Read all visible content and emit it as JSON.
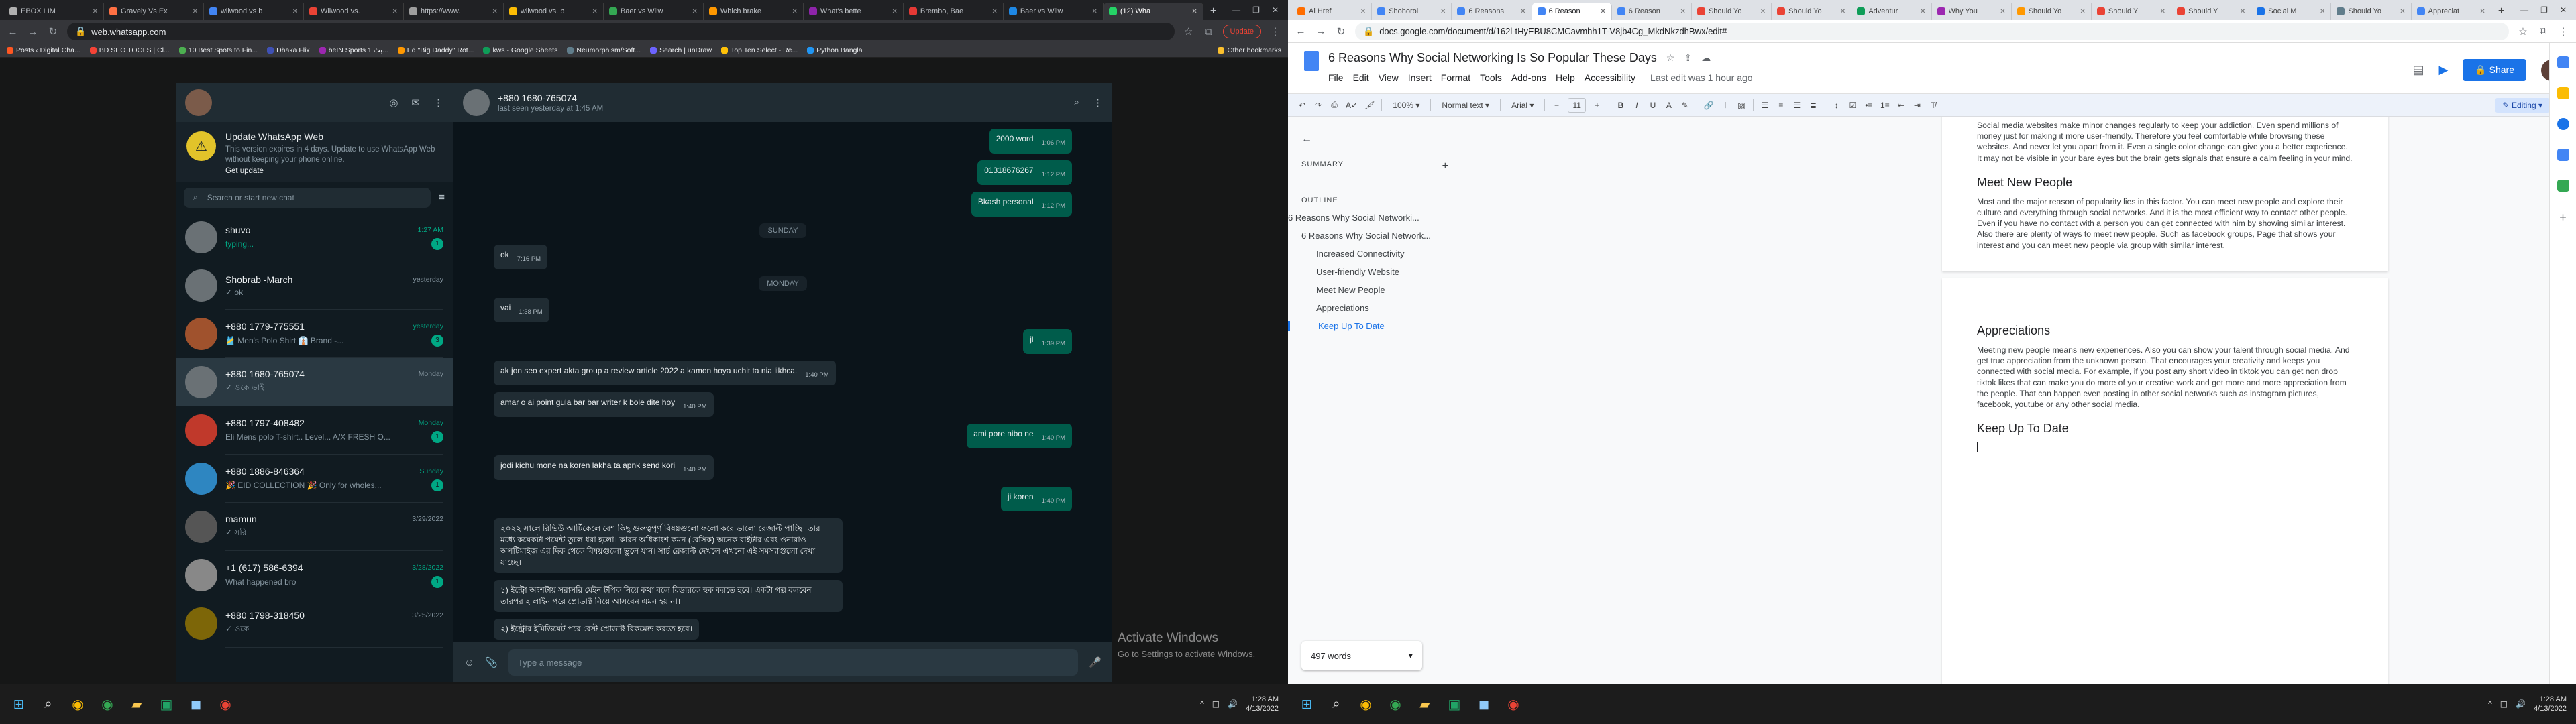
{
  "left": {
    "tabs": [
      {
        "title": "EBOX LIM",
        "color": "#b0b0b0",
        "active": false
      },
      {
        "title": "Gravely Vs Ex",
        "color": "#ff7043",
        "active": false
      },
      {
        "title": "wilwood vs b",
        "color": "#4285f4",
        "active": false
      },
      {
        "title": "Wilwood vs.",
        "color": "#ea4335",
        "active": false
      },
      {
        "title": "https://www.",
        "color": "#9e9e9e",
        "active": false
      },
      {
        "title": "wilwood vs. b",
        "color": "#fbbc04",
        "active": false
      },
      {
        "title": "Baer vs Wilw",
        "color": "#34a853",
        "active": false
      },
      {
        "title": "Which brake",
        "color": "#ff9800",
        "active": false
      },
      {
        "title": "What's bette",
        "color": "#8e24aa",
        "active": false
      },
      {
        "title": "Brembo, Bae",
        "color": "#e53935",
        "active": false
      },
      {
        "title": "Baer vs Wilw",
        "color": "#1e88e5",
        "active": false
      },
      {
        "title": "(12) Wha",
        "color": "#25d366",
        "active": true
      }
    ],
    "url": "web.whatsapp.com",
    "update_label": "Update",
    "bookmarks": [
      {
        "label": "Posts ‹ Digital Cha...",
        "color": "#ff5722"
      },
      {
        "label": "BD SEO TOOLS | Cl...",
        "color": "#f44336"
      },
      {
        "label": "10 Best Spots to Fin...",
        "color": "#4caf50"
      },
      {
        "label": "Dhaka Flix",
        "color": "#3f51b5"
      },
      {
        "label": "beIN Sports 1 بث...",
        "color": "#9c27b0"
      },
      {
        "label": "Ed \"Big Daddy\" Rot...",
        "color": "#ff9800"
      },
      {
        "label": "kws - Google Sheets",
        "color": "#0f9d58"
      },
      {
        "label": "Neumorphism/Soft...",
        "color": "#607d8b"
      },
      {
        "label": "Search | unDraw",
        "color": "#6c63ff"
      },
      {
        "label": "Top Ten Select - Re...",
        "color": "#ffc107"
      },
      {
        "label": "Python Bangla",
        "color": "#2196f3"
      }
    ],
    "other_bookmarks": "Other bookmarks",
    "whatsapp": {
      "notice_title": "Update WhatsApp Web",
      "notice_text": "This version expires in 4 days. Update to use WhatsApp Web without keeping your phone online.",
      "notice_link": "Get update",
      "search_placeholder": "Search or start new chat",
      "chats": [
        {
          "name": "shuvo",
          "time": "1:27 AM",
          "msg": "typing...",
          "badge": "1",
          "selected": false,
          "green": true
        },
        {
          "name": "Shobrab -March",
          "time": "yesterday",
          "msg": "✓ ok",
          "badge": "",
          "selected": false,
          "green": false
        },
        {
          "name": "+880 1779-775551",
          "time": "yesterday",
          "msg": "🎽 Men's Polo Shirt   👔 Brand -...",
          "badge": "3",
          "selected": false,
          "green": false
        },
        {
          "name": "+880 1680-765074",
          "time": "Monday",
          "msg": "✓ ওকে ভাই",
          "badge": "",
          "selected": true,
          "green": false
        },
        {
          "name": "+880 1797-408482",
          "time": "Monday",
          "msg": "Eli Mens polo T-shirt.. Level... A/X  FRESH O...",
          "badge": "1",
          "selected": false,
          "green": false
        },
        {
          "name": "+880 1886-846364",
          "time": "Sunday",
          "msg": "🎉 EID COLLECTION 🎉 Only for wholes...",
          "badge": "1",
          "selected": false,
          "green": false
        },
        {
          "name": "mamun",
          "time": "3/29/2022",
          "msg": "✓ সরি",
          "badge": "",
          "selected": false,
          "green": false
        },
        {
          "name": "+1 (617) 586-6394",
          "time": "3/28/2022",
          "msg": "What happened bro",
          "badge": "1",
          "selected": false,
          "green": false
        },
        {
          "name": "+880 1798-318450",
          "time": "3/25/2022",
          "msg": "✓ ওকে",
          "badge": "",
          "selected": false,
          "green": false
        }
      ],
      "contact_name": "+880 1680-765074",
      "last_seen": "last seen yesterday at 1:45 AM",
      "messages": [
        {
          "kind": "out",
          "text": "2000 word",
          "time": "1:06 PM"
        },
        {
          "kind": "out",
          "text": "01318676267",
          "time": "1:12 PM"
        },
        {
          "kind": "out",
          "text": "Bkash personal",
          "time": "1:12 PM"
        },
        {
          "kind": "sep",
          "text": "SUNDAY",
          "time": ""
        },
        {
          "kind": "in",
          "text": "ok",
          "time": "7:16 PM"
        },
        {
          "kind": "sep",
          "text": "MONDAY",
          "time": ""
        },
        {
          "kind": "in",
          "text": "vai",
          "time": "1:38 PM"
        },
        {
          "kind": "out",
          "text": "jl",
          "time": "1:39 PM"
        },
        {
          "kind": "in",
          "text": "ak jon seo expert akta group a review article 2022 a kamon hoya uchit ta nia likhca.",
          "time": "1:40 PM"
        },
        {
          "kind": "in",
          "text": "amar o ai point gula bar bar writer k bole dite hoy",
          "time": "1:40 PM"
        },
        {
          "kind": "out",
          "text": "ami pore nibo ne",
          "time": "1:40 PM"
        },
        {
          "kind": "in",
          "text": "jodi kichu mone na koren lakha ta apnk send kori",
          "time": "1:40 PM"
        },
        {
          "kind": "out",
          "text": "ji koren",
          "time": "1:40 PM"
        },
        {
          "kind": "in",
          "text": "২০২২ সালে রিভিউ আর্টিকেলে বেশ কিছু গুরুত্বপূর্ণ বিষয়গুলো ফলো করে ভালো রেজাল্ট পাচ্ছি। তার মধ্যে কয়েকটা পয়েন্ট তুলে ধরা হলো। কারন অধিকাংশ কমন (বেসিক) অনেক রাইটার এবং ওনারাও অপটিমাইজ এর দিক থেকে বিষয়গুলো ভুলে যান। সার্চ রেজাল্ট দেখলে এখনো এই সমস্যাগুলো দেখা যাচ্ছে।",
          "time": ""
        },
        {
          "kind": "in",
          "text": "১) ইন্ট্রো অংশটায় সরাসরি মেইন টপিক নিয়ে কথা বলে রিডারকে হুক করতে হবে। একটা গল্প বলবেন তারপর ২ লাইন পরে প্রোডাক্ট নিয়ে আসবেন এমন হয় না।",
          "time": ""
        },
        {
          "kind": "in",
          "text": "২) ইন্ট্রোর ইমিডিয়েট পরে বেস্ট প্রোডাক্ট রিকমেন্ড করতে হবে।",
          "time": ""
        }
      ],
      "input_placeholder": "Type a message"
    },
    "activate_title": "Activate Windows",
    "activate_sub": "Go to Settings to activate Windows.",
    "clock_time": "1:28 AM",
    "clock_date": "4/13/2022"
  },
  "right": {
    "tabs": [
      {
        "title": "Ai Href",
        "color": "#ff6d00",
        "active": false
      },
      {
        "title": "Shohorol",
        "color": "#4285f4",
        "active": false
      },
      {
        "title": "6 Reasons",
        "color": "#4285f4",
        "active": false
      },
      {
        "title": "6 Reason",
        "color": "#4285f4",
        "active": true
      },
      {
        "title": "6 Reason",
        "color": "#4285f4",
        "active": false
      },
      {
        "title": "Should Yo",
        "color": "#ea4335",
        "active": false
      },
      {
        "title": "Should Yo",
        "color": "#ea4335",
        "active": false
      },
      {
        "title": "Adventur",
        "color": "#0f9d58",
        "active": false
      },
      {
        "title": "Why You",
        "color": "#9c27b0",
        "active": false
      },
      {
        "title": "Should Yo",
        "color": "#ff9800",
        "active": false
      },
      {
        "title": "Should Y",
        "color": "#ea4335",
        "active": false
      },
      {
        "title": "Should Y",
        "color": "#ea4335",
        "active": false
      },
      {
        "title": "Social M",
        "color": "#1a73e8",
        "active": false
      },
      {
        "title": "Should Yo",
        "color": "#607d8b",
        "active": false
      },
      {
        "title": "Appreciat",
        "color": "#4285f4",
        "active": false
      }
    ],
    "url": "docs.google.com/document/d/162l-tHyEBU8CMCavmhh1T-V8jb4Cg_MkdNkzdhBwx/edit#",
    "docs": {
      "title": "6 Reasons Why Social Networking Is So Popular These Days",
      "menu": [
        "File",
        "Edit",
        "View",
        "Insert",
        "Format",
        "Tools",
        "Add-ons",
        "Help",
        "Accessibility"
      ],
      "last_edit": "Last edit was 1 hour ago",
      "share_label": "Share",
      "zoom": "100%",
      "style": "Normal text",
      "font": "Arial",
      "font_size": "11",
      "editing_label": "Editing",
      "summary_label": "SUMMARY",
      "outline_label": "OUTLINE",
      "outline": [
        {
          "text": "6 Reasons Why Social Networki...",
          "level": 1
        },
        {
          "text": "6 Reasons Why Social Network...",
          "level": 2
        },
        {
          "text": "Increased Connectivity",
          "level": 3
        },
        {
          "text": "User-friendly Website",
          "level": 3
        },
        {
          "text": "Meet New People",
          "level": 3
        },
        {
          "text": "Appreciations",
          "level": 3
        },
        {
          "text": "Keep Up To Date",
          "level": 4
        }
      ],
      "word_count": "497 words",
      "para_top": "Social media websites make minor changes regularly to keep your addiction. Even spend millions of money just for making it more user-friendly. Therefore you feel comfortable while browsing these websites. And never let you apart from it. Even a single color change can give you a better experience. It may not be visible in your bare eyes but the brain gets signals that ensure a calm feeling in your mind.",
      "h_meet": "Meet New People",
      "para_meet": "Most and the major reason of popularity lies in this factor. You can meet new people and explore their culture and everything through social networks. And it is the most efficient way to contact other people. Even if you have no contact with a person you can get connected with him by showing similar interest. Also there are plenty of ways to meet new people. Such as facebook groups, Page that shows your interest and you can meet new people via group with similar interest.",
      "h_appr": "Appreciations",
      "para_appr": "Meeting new people means new experiences. Also you can show your talent through social media. And get true appreciation from the unknown person. That encourages your creativity and keeps you connected with social media. For example, if you post any short video in tiktok you can get non drop tiktok likes that can make you do more of your creative work and get more and more appreciation from the people. That can happen even posting in other social networks such as instagram pictures, facebook, youtube or any other social media.",
      "h_keep": "Keep Up To Date"
    },
    "clock_time": "1:28 AM",
    "clock_date": "4/13/2022"
  }
}
